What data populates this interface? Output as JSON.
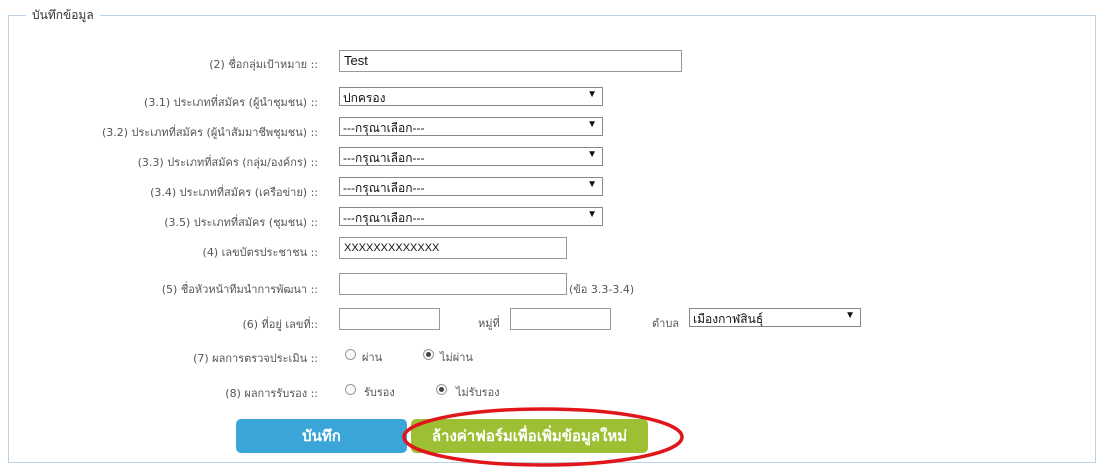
{
  "legend": "บันทึกข้อมูล",
  "fields": {
    "target_group": {
      "label": "(2) ชื่อกลุ่มเป้าหมาย ::",
      "value": "Test"
    },
    "type_3_1": {
      "label": "(3.1) ประเภทที่สมัคร (ผู้นำชุมชน) ::",
      "value": "ปกครอง"
    },
    "type_3_2": {
      "label": "(3.2) ประเภทที่สมัคร (ผู้นำสัมมาชีพชุมชน) ::",
      "value": "---กรุณาเลือก---"
    },
    "type_3_3": {
      "label": "(3.3) ประเภทที่สมัคร (กลุ่ม/องค์กร) ::",
      "value": "---กรุณาเลือก---"
    },
    "type_3_4": {
      "label": "(3.4) ประเภทที่สมัคร (เครือข่าย) ::",
      "value": "---กรุณาเลือก---"
    },
    "type_3_5": {
      "label": "(3.5) ประเภทที่สมัคร (ชุมชน) ::",
      "value": "---กรุณาเลือก---"
    },
    "id_card": {
      "label": "(4) เลขบัตรประชาชน ::",
      "value": "XXXXXXXXXXXXX"
    },
    "leader": {
      "label": "(5) ชื่อหัวหน้าทีมนำการพัฒนา ::",
      "value": "",
      "note": "(ข้อ 3.3-3.4)"
    },
    "address": {
      "label": "(6) ที่อยู่ เลขที่::",
      "house_no": "",
      "moo_label": "หมู่ที่",
      "moo": "",
      "tambon_label": "ตำบล",
      "tambon": "เมืองกาฬสินธุ์"
    },
    "assessment": {
      "label": "(7) ผลการตรวจประเมิน ::",
      "opt_pass": "ผ่าน",
      "opt_fail": "ไม่ผ่าน",
      "selected": "fail"
    },
    "certify": {
      "label": "(8) ผลการรับรอง ::",
      "opt_yes": "รับรอง",
      "opt_no": "ไม่รับรอง",
      "selected": "no"
    }
  },
  "buttons": {
    "save": "บันทึก",
    "clear": "ล้างค่าฟอร์มเพื่อเพิ่มข้อมูลใหม่"
  },
  "colors": {
    "save_bg": "#3ca5d8",
    "clear_bg": "#9cbf33",
    "highlight": "#e0161b"
  }
}
